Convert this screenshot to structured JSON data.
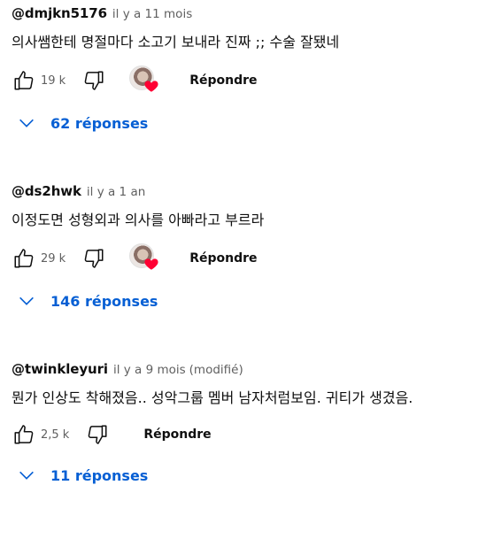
{
  "comments": [
    {
      "author": "@dmjkn5176",
      "time": "il y a 11 mois",
      "edited": "",
      "text": "의사쌤한테 명절마다 소고기 보내라 진짜 ;; 수술 잘됐네",
      "likes": "19 k",
      "creator_heart": true,
      "reply_label": "Répondre",
      "replies_label": "62 réponses"
    },
    {
      "author": "@ds2hwk",
      "time": "il y a 1 an",
      "edited": "",
      "text": "이정도면 성형외과 의사를 아빠라고 부르라",
      "likes": "29 k",
      "creator_heart": true,
      "reply_label": "Répondre",
      "replies_label": "146 réponses"
    },
    {
      "author": "@twinkleyuri",
      "time": "il y a 9 mois",
      "edited": "(modifié)",
      "text": "뭔가 인상도 착해졌음.. 성악그룹 멤버 남자처럼보임. 귀티가 생겼음.",
      "likes": "2,5 k",
      "creator_heart": false,
      "reply_label": "Répondre",
      "replies_label": "11 réponses"
    }
  ],
  "colors": {
    "link_blue": "#065fd4",
    "meta_gray": "#606060",
    "heart_red": "#ff0033"
  },
  "icons": {
    "like": "thumbs-up-outline-icon",
    "dislike": "thumbs-down-outline-icon",
    "heart": "heart-icon",
    "chevron": "chevron-down-icon"
  }
}
